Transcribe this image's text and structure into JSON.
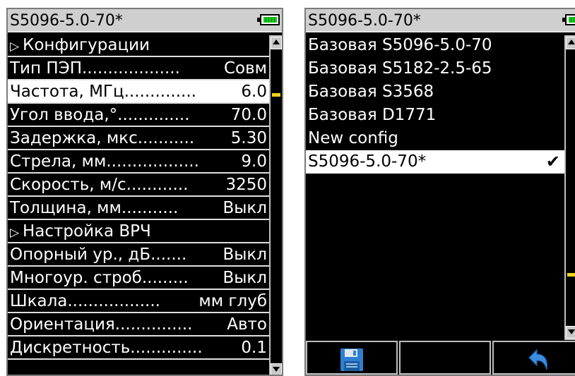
{
  "left_panel": {
    "title": "S5096-5.0-70*",
    "battery_icon": "battery-full-icon",
    "battery_color": "#18c41c",
    "rows": [
      {
        "label": "Конфигурации",
        "value": "",
        "type": "section"
      },
      {
        "label": "Тип ПЭП...................",
        "value": "Совм",
        "type": "item"
      },
      {
        "label": "Частота, МГц..............",
        "value": "6.0",
        "type": "item",
        "selected": true
      },
      {
        "label": "Угол ввода,°..............",
        "value": "70.0",
        "type": "item"
      },
      {
        "label": "Задержка, мкс...........",
        "value": "5.30",
        "type": "item"
      },
      {
        "label": "Стрела, мм..................",
        "value": "9.0",
        "type": "item"
      },
      {
        "label": "Скорость, м/с............",
        "value": "3250",
        "type": "item"
      },
      {
        "label": "Толщина, мм...........",
        "value": "Выкл",
        "type": "item"
      },
      {
        "label": "Настройка ВРЧ",
        "value": "",
        "type": "section"
      },
      {
        "label": "Опорный ур., дБ.......",
        "value": "Выкл",
        "type": "item"
      },
      {
        "label": "Многоур. строб.........",
        "value": "Выкл",
        "type": "item"
      },
      {
        "label": "Шкала..................",
        "value": "мм глуб",
        "type": "item"
      },
      {
        "label": "Ориентация...............",
        "value": "Авто",
        "type": "item"
      },
      {
        "label": "Дискретность..............",
        "value": "0.1",
        "type": "item"
      }
    ],
    "scroll_position": 0.14
  },
  "right_panel": {
    "title": "S5096-5.0-70*",
    "battery_icon": "battery-full-icon",
    "items": [
      {
        "label": "Базовая S5096-5.0-70"
      },
      {
        "label": "Базовая S5182-2.5-65"
      },
      {
        "label": "Базовая S3568"
      },
      {
        "label": "Базовая D1771"
      },
      {
        "label": "New config"
      },
      {
        "label": "S5096-5.0-70*",
        "selected": true,
        "check": "✔"
      }
    ],
    "scroll_position": 0.82,
    "function_keys": [
      {
        "icon": "save-floppy-icon"
      },
      {
        "icon": ""
      },
      {
        "icon": "undo-arrow-icon"
      }
    ]
  },
  "colors": {
    "title_bg": "#cfcfcf",
    "scroll_thumb": "#f2d21a",
    "floppy": "#2f7fd0",
    "undo": "#3c8fe0"
  }
}
